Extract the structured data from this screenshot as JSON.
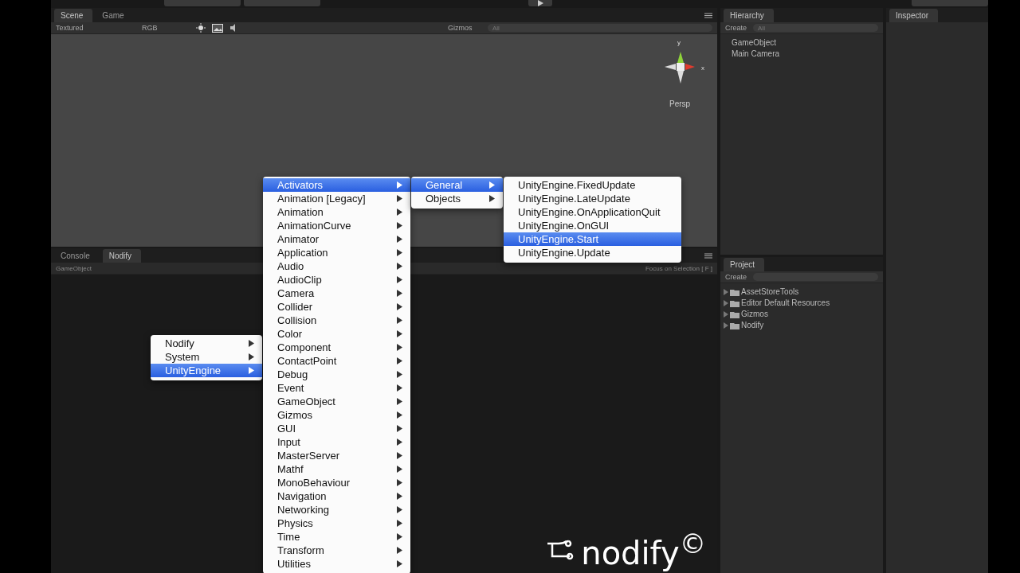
{
  "scene_panel": {
    "tabs": [
      {
        "label": "Scene",
        "selected": true
      },
      {
        "label": "Game",
        "selected": false
      }
    ],
    "shading": "Textured",
    "render_mode": "RGB",
    "gizmos": "Gizmos",
    "search_placeholder": "All",
    "axes": [
      "y",
      "x"
    ],
    "projection": "Persp"
  },
  "hierarchy": {
    "title": "Hierarchy",
    "create": "Create",
    "search_placeholder": "All",
    "items": [
      "GameObject",
      "Main Camera"
    ]
  },
  "inspector": {
    "title": "Inspector"
  },
  "bottom_panel": {
    "tabs": [
      {
        "label": "Console",
        "selected": false
      },
      {
        "label": "Nodify",
        "selected": true
      }
    ],
    "breadcrumb": "GameObject",
    "focus_hint": "Focus on Selection [ F ]"
  },
  "project": {
    "title": "Project",
    "create": "Create",
    "folders": [
      "AssetStoreTools",
      "Editor Default Resources",
      "Gizmos",
      "Nodify"
    ]
  },
  "menus": [
    {
      "arrows": true,
      "items": [
        {
          "label": "Nodify",
          "selected": false
        },
        {
          "label": "System",
          "selected": false
        },
        {
          "label": "UnityEngine",
          "selected": true
        }
      ]
    },
    {
      "arrows": true,
      "items": [
        {
          "label": "Activators",
          "selected": true
        },
        {
          "label": "Animation [Legacy]",
          "selected": false
        },
        {
          "label": "Animation",
          "selected": false
        },
        {
          "label": "AnimationCurve",
          "selected": false
        },
        {
          "label": "Animator",
          "selected": false
        },
        {
          "label": "Application",
          "selected": false
        },
        {
          "label": "Audio",
          "selected": false
        },
        {
          "label": "AudioClip",
          "selected": false
        },
        {
          "label": "Camera",
          "selected": false
        },
        {
          "label": "Collider",
          "selected": false
        },
        {
          "label": "Collision",
          "selected": false
        },
        {
          "label": "Color",
          "selected": false
        },
        {
          "label": "Component",
          "selected": false
        },
        {
          "label": "ContactPoint",
          "selected": false
        },
        {
          "label": "Debug",
          "selected": false
        },
        {
          "label": "Event",
          "selected": false
        },
        {
          "label": "GameObject",
          "selected": false
        },
        {
          "label": "Gizmos",
          "selected": false
        },
        {
          "label": "GUI",
          "selected": false
        },
        {
          "label": "Input",
          "selected": false
        },
        {
          "label": "MasterServer",
          "selected": false
        },
        {
          "label": "Mathf",
          "selected": false
        },
        {
          "label": "MonoBehaviour",
          "selected": false
        },
        {
          "label": "Navigation",
          "selected": false
        },
        {
          "label": "Networking",
          "selected": false
        },
        {
          "label": "Physics",
          "selected": false
        },
        {
          "label": "Time",
          "selected": false
        },
        {
          "label": "Transform",
          "selected": false
        },
        {
          "label": "Utilities",
          "selected": false
        }
      ]
    },
    {
      "arrows": true,
      "items": [
        {
          "label": "General",
          "selected": true
        },
        {
          "label": "Objects",
          "selected": false
        }
      ]
    },
    {
      "arrows": false,
      "items": [
        {
          "label": "UnityEngine.FixedUpdate",
          "selected": false
        },
        {
          "label": "UnityEngine.LateUpdate",
          "selected": false
        },
        {
          "label": "UnityEngine.OnApplicationQuit",
          "selected": false
        },
        {
          "label": "UnityEngine.OnGUI",
          "selected": false
        },
        {
          "label": "UnityEngine.Start",
          "selected": true
        },
        {
          "label": "UnityEngine.Update",
          "selected": false
        }
      ]
    }
  ],
  "logo": {
    "text": "nodify$^{©}$"
  }
}
